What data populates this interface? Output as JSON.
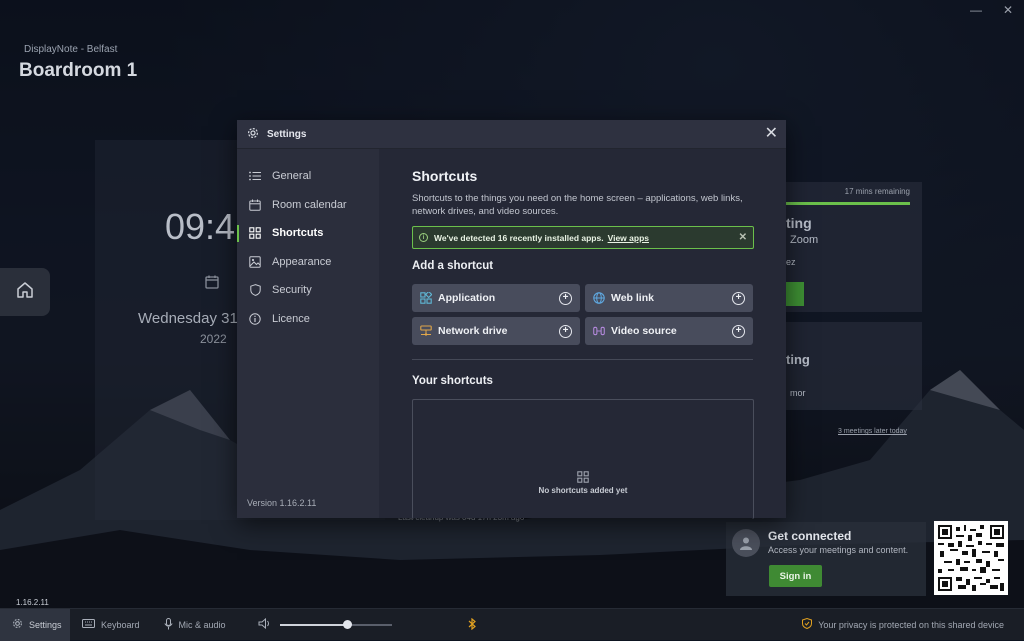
{
  "header": {
    "location": "DisplayNote  -  Belfast",
    "room_name": "Boardroom 1"
  },
  "window_controls": {
    "minimize": "—",
    "close": "✕"
  },
  "background": {
    "clock": "09:4",
    "date": "Wednesday 31",
    "year": "2022",
    "meeting_card": {
      "remaining": "17 mins remaining",
      "title": "ting",
      "subtitle": "Zoom",
      "organizer": "ez"
    },
    "next_card": {
      "title": "ting",
      "organizer": "mor"
    },
    "later_link": "3 meetings later today",
    "cleanup_text": "Last cleanup was 04d 17h 23m ago"
  },
  "get_connected": {
    "title": "Get connected",
    "subtitle": "Access your meetings and content.",
    "signin_label": "Sign in"
  },
  "bottom_bar": {
    "version": "1.16.2.11",
    "settings": "Settings",
    "keyboard": "Keyboard",
    "mic_audio": "Mic & audio",
    "volume_percent": 60,
    "privacy": "Your privacy is protected on this shared device"
  },
  "settings_modal": {
    "title": "Settings",
    "nav": [
      {
        "label": "General",
        "icon": "list-icon"
      },
      {
        "label": "Room calendar",
        "icon": "calendar-icon"
      },
      {
        "label": "Shortcuts",
        "icon": "grid-icon",
        "selected": true
      },
      {
        "label": "Appearance",
        "icon": "image-icon"
      },
      {
        "label": "Security",
        "icon": "shield-icon"
      },
      {
        "label": "Licence",
        "icon": "info-icon"
      }
    ],
    "version": "Version 1.16.2.11",
    "content": {
      "heading": "Shortcuts",
      "description": "Shortcuts to the things you need on the home screen – applications, web links, network drives, and video sources.",
      "notice_text": "We've detected 16 recently installed apps.",
      "notice_link": "View apps",
      "add_heading": "Add a shortcut",
      "add_buttons": [
        "Application",
        "Web link",
        "Network drive",
        "Video source"
      ],
      "your_heading": "Your shortcuts",
      "empty_text": "No shortcuts added yet"
    }
  },
  "colors": {
    "accent": "#6bc04b",
    "modal_bg": "#272a38",
    "button_bg": "#484c5c"
  }
}
